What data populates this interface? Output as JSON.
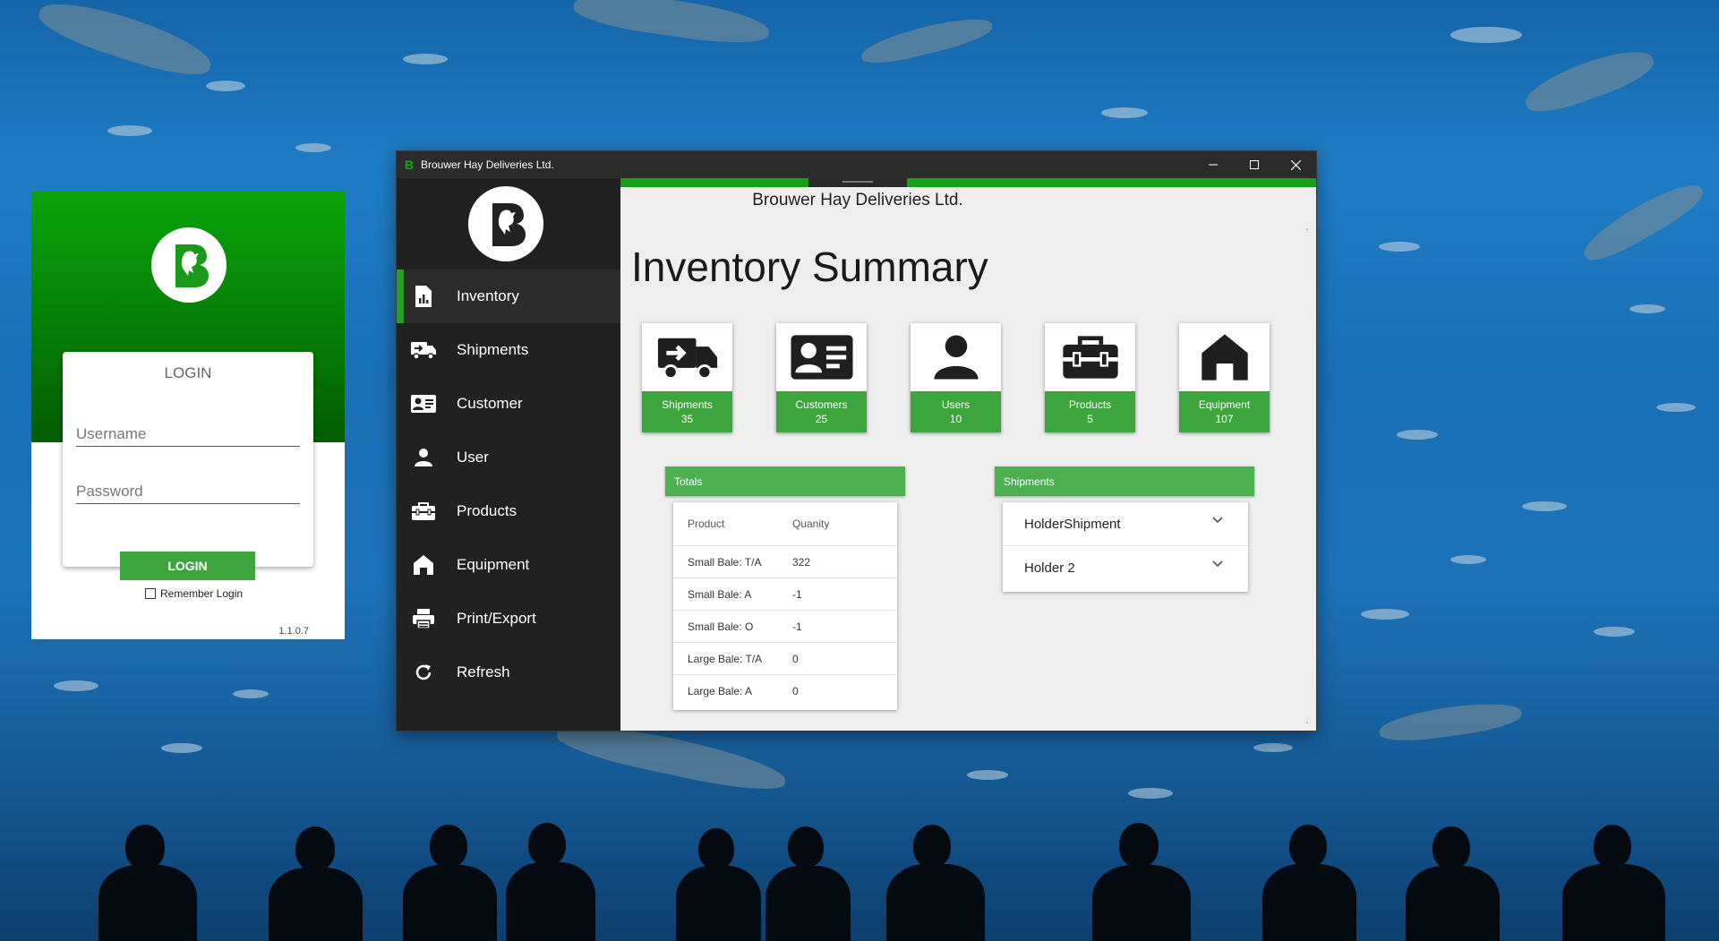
{
  "login": {
    "title": "LOGIN",
    "username_placeholder": "Username",
    "password_placeholder": "Password",
    "button_label": "LOGIN",
    "remember_label": "Remember Login",
    "remember_checked": false,
    "version": "1.1.0.7",
    "logo_icon": "horse-b-logo-icon"
  },
  "main_window": {
    "title": "Brouwer Hay Deliveries Ltd.",
    "controls": [
      "minimize",
      "maximize",
      "close"
    ]
  },
  "sidebar": {
    "logo_icon": "horse-b-logo-icon",
    "items": [
      {
        "label": "Inventory",
        "icon": "chart-document-icon",
        "active": true
      },
      {
        "label": "Shipments",
        "icon": "truck-arrow-icon",
        "active": false
      },
      {
        "label": "Customer",
        "icon": "id-card-icon",
        "active": false
      },
      {
        "label": "User",
        "icon": "person-icon",
        "active": false
      },
      {
        "label": "Products",
        "icon": "toolbox-icon",
        "active": false
      },
      {
        "label": "Equipment",
        "icon": "house-icon",
        "active": false
      },
      {
        "label": "Print/Export",
        "icon": "printer-icon",
        "active": false
      },
      {
        "label": "Refresh",
        "icon": "refresh-icon",
        "active": false
      }
    ]
  },
  "content": {
    "company": "Brouwer Hay Deliveries Ltd.",
    "page_title": "Inventory Summary",
    "tiles": [
      {
        "label": "Shipments",
        "count": "35",
        "icon": "truck-arrow-icon"
      },
      {
        "label": "Customers",
        "count": "25",
        "icon": "id-card-icon"
      },
      {
        "label": "Users",
        "count": "10",
        "icon": "person-icon"
      },
      {
        "label": "Products",
        "count": "5",
        "icon": "toolbox-icon"
      },
      {
        "label": "Equipment",
        "count": "107",
        "icon": "house-icon"
      }
    ],
    "totals": {
      "heading": "Totals",
      "columns": [
        "Product",
        "Quanity"
      ],
      "rows": [
        [
          "Small Bale: T/A",
          "322"
        ],
        [
          "Small Bale: A",
          "-1"
        ],
        [
          "Small Bale: O",
          "-1"
        ],
        [
          "Large Bale: T/A",
          "0"
        ],
        [
          "Large Bale: A",
          "0"
        ]
      ]
    },
    "shipments": {
      "heading": "Shipments",
      "items": [
        "HolderShipment",
        "Holder 2"
      ]
    }
  },
  "colors": {
    "accent_green": "#3da53d",
    "sidebar_bg": "#212121",
    "titlebar_bg": "#2b2b2b"
  }
}
